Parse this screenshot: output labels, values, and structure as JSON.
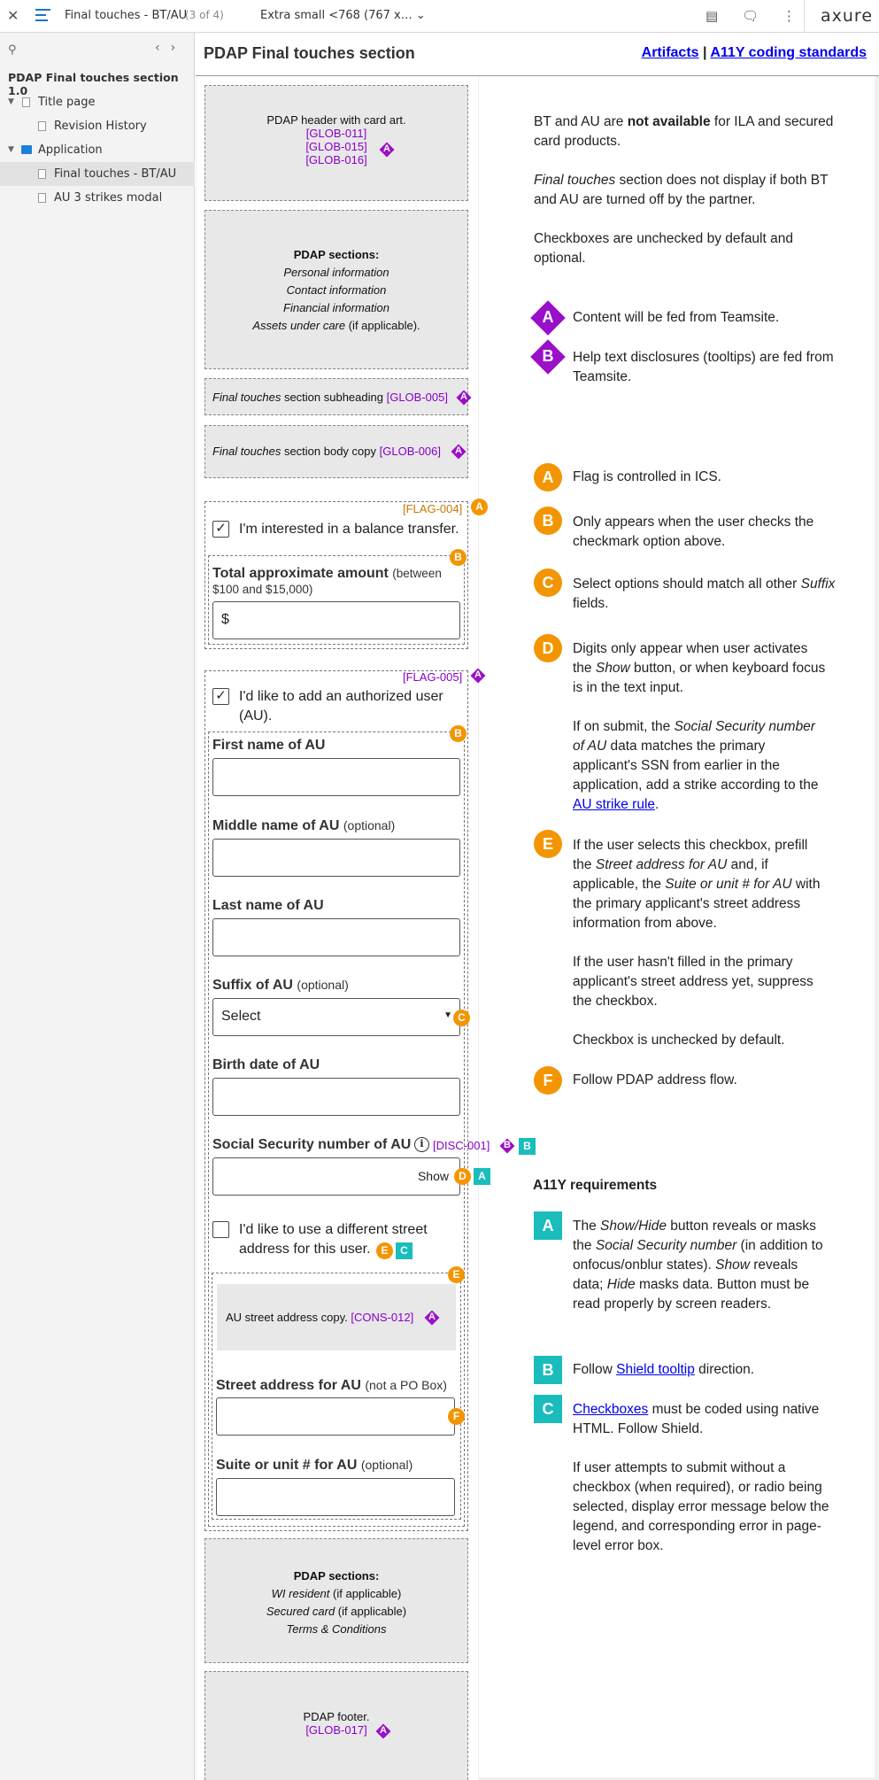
{
  "topbar": {
    "close_icon": "close-icon",
    "page_title": "Final touches - BT/AU",
    "page_count": "(3 of 4)",
    "breakpoint": "Extra small <768 (767 x…"
  },
  "sidebar": {
    "project": "PDAP Final touches section 1.0",
    "items": [
      {
        "label": "Title page"
      },
      {
        "label": "Revision History"
      },
      {
        "label": "Application"
      },
      {
        "label": "Final touches - BT/AU"
      },
      {
        "label": "AU 3 strikes modal"
      }
    ]
  },
  "header": {
    "title": "PDAP Final touches section",
    "link1": "Artifacts",
    "link_sep": "|",
    "link2": "A11Y coding standards",
    "logo": "axure"
  },
  "mock": {
    "pdap_header": {
      "text": "PDAP header with card art.",
      "refs": [
        "[GLOB-011]",
        "[GLOB-015]",
        "[GLOB-016]"
      ]
    },
    "sections_top": {
      "title": "PDAP sections:",
      "items": [
        "Personal information",
        "Contact information",
        "Financial information",
        "Assets under care"
      ],
      "suffix": " (if applicable)."
    },
    "subheading": {
      "em": "Final touches",
      "text": " section subheading ",
      "ref": "[GLOB-005]"
    },
    "bodycopy": {
      "em": "Final touches",
      "text": " section body copy ",
      "ref": "[GLOB-006]"
    },
    "bt": {
      "flag": "[FLAG-004]",
      "checkbox_label": "I'm interested in a balance transfer.",
      "amount_label": "Total approximate amount",
      "amount_hint": "(between $100 and $15,000)",
      "amount_prefix": "$"
    },
    "au": {
      "flag": "[FLAG-005]",
      "checkbox_label": "I'd like to add an authorized user (AU).",
      "first": "First name of AU",
      "middle": "Middle name of AU",
      "optional": "(optional)",
      "last": "Last name of AU",
      "suffix": "Suffix of AU",
      "select_value": "Select",
      "birth": "Birth date of AU",
      "ssn": "Social Security number of AU",
      "ssn_ref": "[DISC-001]",
      "show": "Show",
      "diff_address": "I'd like to use a different street address for this user.",
      "address_copy": "AU street address copy.",
      "address_ref": "[CONS-012]",
      "street": "Street address for AU",
      "street_hint": "(not a PO Box)",
      "suite": "Suite or unit # for AU"
    },
    "sections_bottom": {
      "title": "PDAP sections:",
      "items": [
        "WI resident",
        "Secured card",
        "Terms & Conditions"
      ],
      "suffix": " (if applicable)"
    },
    "footer": {
      "text": "PDAP footer.",
      "ref": "[GLOB-017]"
    }
  },
  "notes": {
    "intro1_a": "BT and AU are ",
    "intro1_b": "not available",
    "intro1_c": " for ILA and secured card products.",
    "intro2_em": "Final touches",
    "intro2": " section does not display if both BT and AU are turned off by the partner.",
    "intro3": "Checkboxes are unchecked by default and optional.",
    "diamondA": "Content will be fed from Teamsite.",
    "diamondB": "Help text disclosures (tooltips) are fed from Teamsite.",
    "A": "Flag is controlled in ICS.",
    "B": "Only appears when the user checks the checkmark option above.",
    "C_1": "Select options should match all other ",
    "C_em": "Suffix",
    "C_2": " fields.",
    "D_1": "Digits only appear when user activates the ",
    "D_em": "Show",
    "D_2": " button, or when keyboard focus is in the text input.",
    "D2_1": "If on submit, the ",
    "D2_em": "Social Security number of AU",
    "D2_2": " data matches the primary applicant's SSN from earlier in the application, add a strike according to the ",
    "D2_link": "AU strike rule",
    "D2_3": ".",
    "E_1": "If the user selects this checkbox, prefill the ",
    "E_em1": "Street address for AU",
    "E_2": " and, if applicable, the ",
    "E_em2": "Suite or unit # for AU",
    "E_3": " with the primary applicant's street address information from above.",
    "E2": "If the user hasn't filled in the primary applicant's street address yet, suppress the checkbox.",
    "E3": "Checkbox is unchecked by default.",
    "F": "Follow PDAP address flow.",
    "a11y_title": "A11Y requirements",
    "sA_1": "The ",
    "sA_em1": "Show/Hide",
    "sA_2": " button reveals or masks the ",
    "sA_em2": "Social Security number",
    "sA_3": " (in addition to onfocus/onblur states). ",
    "sA_em3": "Show",
    "sA_4": " reveals data; ",
    "sA_em4": "Hide",
    "sA_5": " masks data. Button must be read properly by screen readers.",
    "sB_1": "Follow ",
    "sB_link": "Shield tooltip",
    "sB_2": " direction.",
    "sC_link": "Checkboxes",
    "sC_1": " must be coded using native HTML. Follow Shield.",
    "sC2": "If user attempts to submit without a checkbox (when required), or radio being selected, display error message below the legend, and corresponding error in page-level error box."
  },
  "markers": {
    "A": "A",
    "B": "B",
    "C": "C",
    "D": "D",
    "E": "E",
    "F": "F"
  },
  "colors": {
    "purple": "#9a0fc8",
    "orange": "#f39500",
    "teal": "#1abcbc",
    "link": "#0000ee"
  }
}
